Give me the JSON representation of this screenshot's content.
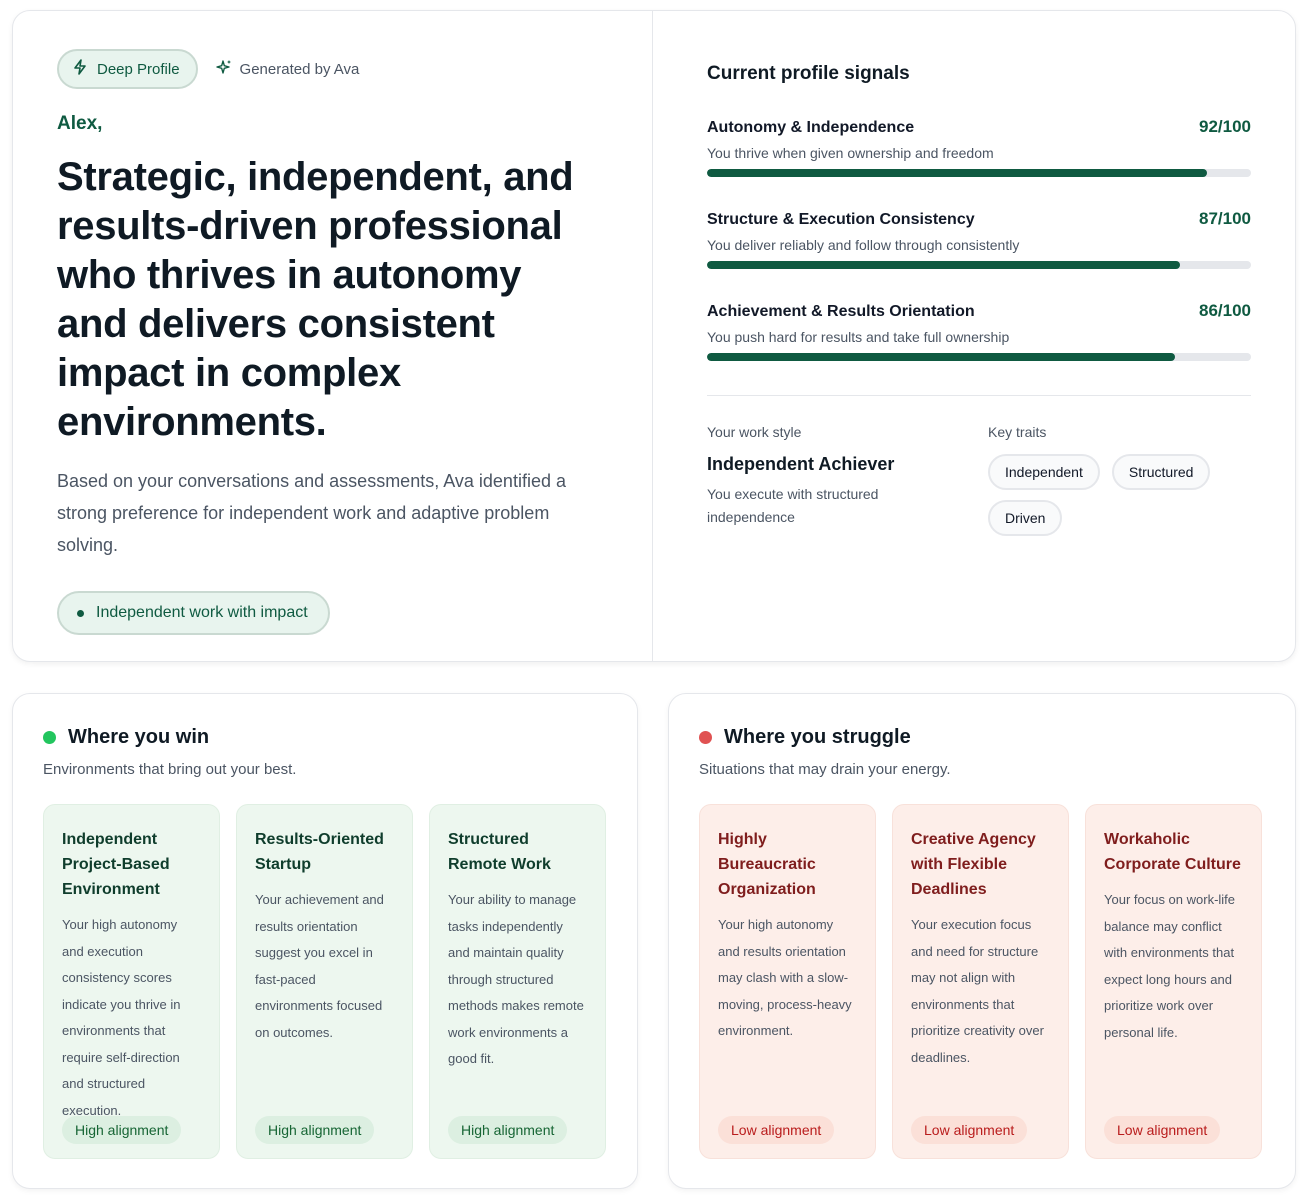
{
  "hero": {
    "badge_label": "Deep Profile",
    "generated_label": "Generated by Ava",
    "greeting": "Alex,",
    "headline": "Strategic, independent, and results-driven professional who thrives in autonomy and delivers consistent impact in complex environments.",
    "summary": "Based on your conversations and assessments, Ava identified a strong preference for independent work and adaptive problem solving.",
    "focus_pill": "Independent work with impact"
  },
  "signals": {
    "title": "Current profile signals",
    "items": [
      {
        "name": "Autonomy & Independence",
        "score": "92/100",
        "value": 92,
        "desc": "You thrive when given ownership and freedom"
      },
      {
        "name": "Structure & Execution Consistency",
        "score": "87/100",
        "value": 87,
        "desc": "You deliver reliably and follow through consistently"
      },
      {
        "name": "Achievement & Results Orientation",
        "score": "86/100",
        "value": 86,
        "desc": "You push hard for results and take full ownership"
      }
    ]
  },
  "work_style": {
    "label": "Your work style",
    "title": "Independent Achiever",
    "desc": "You execute with structured independence"
  },
  "key_traits": {
    "label": "Key traits",
    "items": [
      "Independent",
      "Structured",
      "Driven"
    ]
  },
  "win": {
    "title": "Where you win",
    "subtitle": "Environments that bring out your best.",
    "dot_color": "#22c55e",
    "tiles": [
      {
        "title": "Independent Project-Based Environment",
        "desc": "Your high autonomy and execution consistency scores indicate you thrive in environments that require self-direction and structured execution.",
        "badge": "High alignment"
      },
      {
        "title": "Results-Oriented Startup",
        "desc": "Your achievement and results orientation suggest you excel in fast-paced environments focused on outcomes.",
        "badge": "High alignment"
      },
      {
        "title": "Structured Remote Work",
        "desc": "Your ability to manage tasks independently and maintain quality through structured methods makes remote work environments a good fit.",
        "badge": "High alignment"
      }
    ]
  },
  "struggle": {
    "title": "Where you struggle",
    "subtitle": "Situations that may drain your energy.",
    "dot_color": "#e05252",
    "tiles": [
      {
        "title": "Highly Bureaucratic Organization",
        "desc": "Your high autonomy and results orientation may clash with a slow-moving, process-heavy environment.",
        "badge": "Low alignment"
      },
      {
        "title": "Creative Agency with Flexible Deadlines",
        "desc": "Your execution focus and need for structure may not align with environments that prioritize creativity over deadlines.",
        "badge": "Low alignment"
      },
      {
        "title": "Workaholic Corporate Culture",
        "desc": "Your focus on work-life balance may conflict with environments that expect long hours and prioritize work over personal life.",
        "badge": "Low alignment"
      }
    ]
  }
}
